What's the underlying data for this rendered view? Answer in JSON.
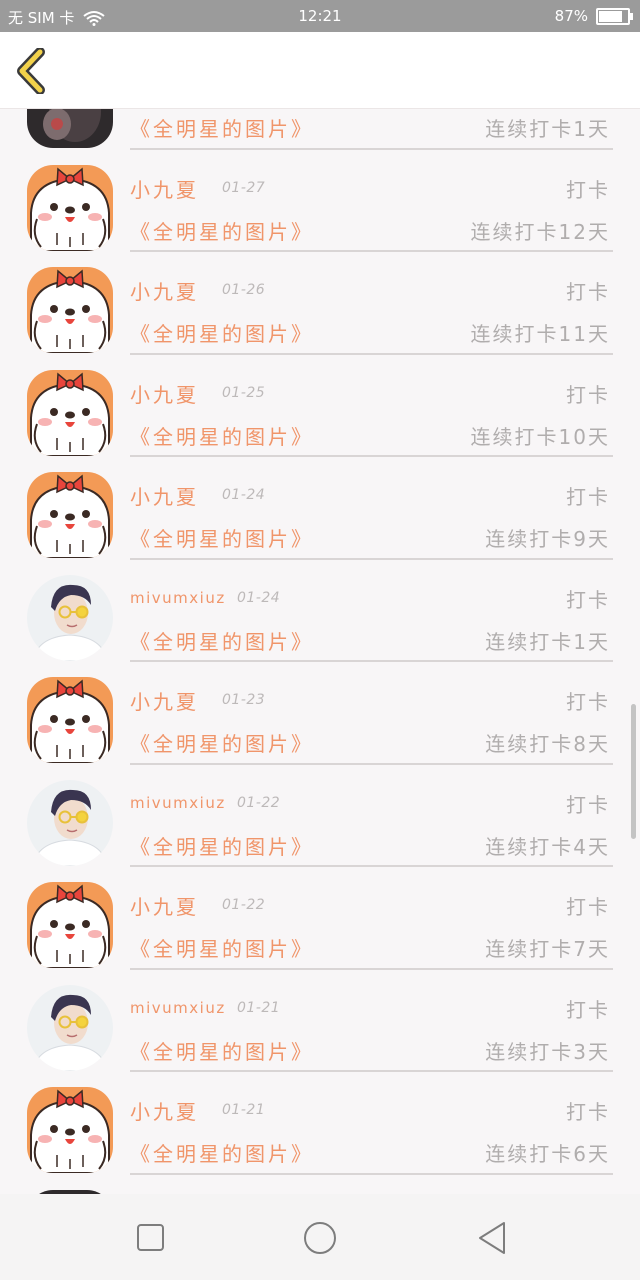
{
  "status_bar": {
    "carrier": "无 SIM 卡",
    "time": "12:21",
    "battery_text": "87%",
    "battery_level": 0.87
  },
  "header": {
    "back_icon": "chevron-left-icon"
  },
  "records": [
    {
      "user": "",
      "date": "",
      "action": "",
      "book": "《全明星的图片》",
      "streak": "连续打卡1天",
      "avatar": "photo-dark"
    },
    {
      "user": "小九夏",
      "date": "01-27",
      "action": "打卡",
      "book": "《全明星的图片》",
      "streak": "连续打卡12天",
      "avatar": "puppy"
    },
    {
      "user": "小九夏",
      "date": "01-26",
      "action": "打卡",
      "book": "《全明星的图片》",
      "streak": "连续打卡11天",
      "avatar": "puppy"
    },
    {
      "user": "小九夏",
      "date": "01-25",
      "action": "打卡",
      "book": "《全明星的图片》",
      "streak": "连续打卡10天",
      "avatar": "puppy"
    },
    {
      "user": "小九夏",
      "date": "01-24",
      "action": "打卡",
      "book": "《全明星的图片》",
      "streak": "连续打卡9天",
      "avatar": "puppy"
    },
    {
      "user": "mivumxiuz",
      "date": "01-24",
      "action": "打卡",
      "book": "《全明星的图片》",
      "streak": "连续打卡1天",
      "avatar": "boy"
    },
    {
      "user": "小九夏",
      "date": "01-23",
      "action": "打卡",
      "book": "《全明星的图片》",
      "streak": "连续打卡8天",
      "avatar": "puppy"
    },
    {
      "user": "mivumxiuz",
      "date": "01-22",
      "action": "打卡",
      "book": "《全明星的图片》",
      "streak": "连续打卡4天",
      "avatar": "boy"
    },
    {
      "user": "小九夏",
      "date": "01-22",
      "action": "打卡",
      "book": "《全明星的图片》",
      "streak": "连续打卡7天",
      "avatar": "puppy"
    },
    {
      "user": "mivumxiuz",
      "date": "01-21",
      "action": "打卡",
      "book": "《全明星的图片》",
      "streak": "连续打卡3天",
      "avatar": "boy"
    },
    {
      "user": "小九夏",
      "date": "01-21",
      "action": "打卡",
      "book": "《全明星的图片》",
      "streak": "连续打卡6天",
      "avatar": "puppy"
    },
    {
      "user": "",
      "date": "",
      "action": "",
      "book": "",
      "streak": "",
      "avatar": "photo-dark"
    }
  ],
  "navigation_bar": {
    "recents_icon": "square-icon",
    "home_icon": "circle-icon",
    "back_icon": "triangle-back-icon"
  },
  "colors": {
    "accent": "#f0956a",
    "secondary_text": "#b0adad",
    "background": "#f8f6f7"
  }
}
